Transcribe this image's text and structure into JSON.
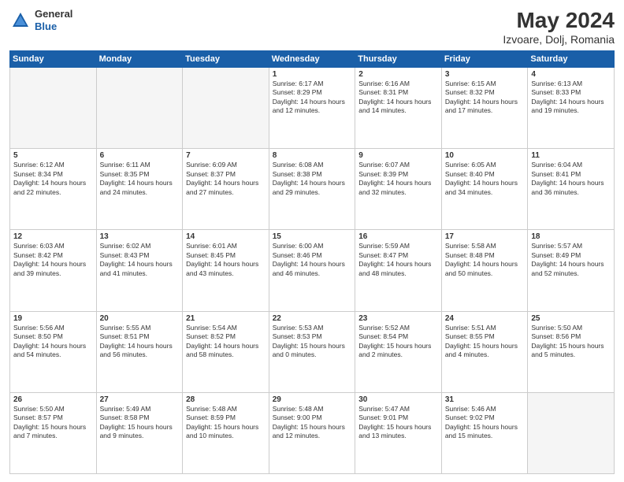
{
  "header": {
    "logo": {
      "general": "General",
      "blue": "Blue"
    },
    "title": "May 2024",
    "subtitle": "Izvoare, Dolj, Romania"
  },
  "days_of_week": [
    "Sunday",
    "Monday",
    "Tuesday",
    "Wednesday",
    "Thursday",
    "Friday",
    "Saturday"
  ],
  "weeks": [
    [
      {
        "day": "",
        "empty": true
      },
      {
        "day": "",
        "empty": true
      },
      {
        "day": "",
        "empty": true
      },
      {
        "day": "1",
        "sunrise": "Sunrise: 6:17 AM",
        "sunset": "Sunset: 8:29 PM",
        "daylight": "Daylight: 14 hours and 12 minutes."
      },
      {
        "day": "2",
        "sunrise": "Sunrise: 6:16 AM",
        "sunset": "Sunset: 8:31 PM",
        "daylight": "Daylight: 14 hours and 14 minutes."
      },
      {
        "day": "3",
        "sunrise": "Sunrise: 6:15 AM",
        "sunset": "Sunset: 8:32 PM",
        "daylight": "Daylight: 14 hours and 17 minutes."
      },
      {
        "day": "4",
        "sunrise": "Sunrise: 6:13 AM",
        "sunset": "Sunset: 8:33 PM",
        "daylight": "Daylight: 14 hours and 19 minutes."
      }
    ],
    [
      {
        "day": "5",
        "sunrise": "Sunrise: 6:12 AM",
        "sunset": "Sunset: 8:34 PM",
        "daylight": "Daylight: 14 hours and 22 minutes."
      },
      {
        "day": "6",
        "sunrise": "Sunrise: 6:11 AM",
        "sunset": "Sunset: 8:35 PM",
        "daylight": "Daylight: 14 hours and 24 minutes."
      },
      {
        "day": "7",
        "sunrise": "Sunrise: 6:09 AM",
        "sunset": "Sunset: 8:37 PM",
        "daylight": "Daylight: 14 hours and 27 minutes."
      },
      {
        "day": "8",
        "sunrise": "Sunrise: 6:08 AM",
        "sunset": "Sunset: 8:38 PM",
        "daylight": "Daylight: 14 hours and 29 minutes."
      },
      {
        "day": "9",
        "sunrise": "Sunrise: 6:07 AM",
        "sunset": "Sunset: 8:39 PM",
        "daylight": "Daylight: 14 hours and 32 minutes."
      },
      {
        "day": "10",
        "sunrise": "Sunrise: 6:05 AM",
        "sunset": "Sunset: 8:40 PM",
        "daylight": "Daylight: 14 hours and 34 minutes."
      },
      {
        "day": "11",
        "sunrise": "Sunrise: 6:04 AM",
        "sunset": "Sunset: 8:41 PM",
        "daylight": "Daylight: 14 hours and 36 minutes."
      }
    ],
    [
      {
        "day": "12",
        "sunrise": "Sunrise: 6:03 AM",
        "sunset": "Sunset: 8:42 PM",
        "daylight": "Daylight: 14 hours and 39 minutes."
      },
      {
        "day": "13",
        "sunrise": "Sunrise: 6:02 AM",
        "sunset": "Sunset: 8:43 PM",
        "daylight": "Daylight: 14 hours and 41 minutes."
      },
      {
        "day": "14",
        "sunrise": "Sunrise: 6:01 AM",
        "sunset": "Sunset: 8:45 PM",
        "daylight": "Daylight: 14 hours and 43 minutes."
      },
      {
        "day": "15",
        "sunrise": "Sunrise: 6:00 AM",
        "sunset": "Sunset: 8:46 PM",
        "daylight": "Daylight: 14 hours and 46 minutes."
      },
      {
        "day": "16",
        "sunrise": "Sunrise: 5:59 AM",
        "sunset": "Sunset: 8:47 PM",
        "daylight": "Daylight: 14 hours and 48 minutes."
      },
      {
        "day": "17",
        "sunrise": "Sunrise: 5:58 AM",
        "sunset": "Sunset: 8:48 PM",
        "daylight": "Daylight: 14 hours and 50 minutes."
      },
      {
        "day": "18",
        "sunrise": "Sunrise: 5:57 AM",
        "sunset": "Sunset: 8:49 PM",
        "daylight": "Daylight: 14 hours and 52 minutes."
      }
    ],
    [
      {
        "day": "19",
        "sunrise": "Sunrise: 5:56 AM",
        "sunset": "Sunset: 8:50 PM",
        "daylight": "Daylight: 14 hours and 54 minutes."
      },
      {
        "day": "20",
        "sunrise": "Sunrise: 5:55 AM",
        "sunset": "Sunset: 8:51 PM",
        "daylight": "Daylight: 14 hours and 56 minutes."
      },
      {
        "day": "21",
        "sunrise": "Sunrise: 5:54 AM",
        "sunset": "Sunset: 8:52 PM",
        "daylight": "Daylight: 14 hours and 58 minutes."
      },
      {
        "day": "22",
        "sunrise": "Sunrise: 5:53 AM",
        "sunset": "Sunset: 8:53 PM",
        "daylight": "Daylight: 15 hours and 0 minutes."
      },
      {
        "day": "23",
        "sunrise": "Sunrise: 5:52 AM",
        "sunset": "Sunset: 8:54 PM",
        "daylight": "Daylight: 15 hours and 2 minutes."
      },
      {
        "day": "24",
        "sunrise": "Sunrise: 5:51 AM",
        "sunset": "Sunset: 8:55 PM",
        "daylight": "Daylight: 15 hours and 4 minutes."
      },
      {
        "day": "25",
        "sunrise": "Sunrise: 5:50 AM",
        "sunset": "Sunset: 8:56 PM",
        "daylight": "Daylight: 15 hours and 5 minutes."
      }
    ],
    [
      {
        "day": "26",
        "sunrise": "Sunrise: 5:50 AM",
        "sunset": "Sunset: 8:57 PM",
        "daylight": "Daylight: 15 hours and 7 minutes."
      },
      {
        "day": "27",
        "sunrise": "Sunrise: 5:49 AM",
        "sunset": "Sunset: 8:58 PM",
        "daylight": "Daylight: 15 hours and 9 minutes."
      },
      {
        "day": "28",
        "sunrise": "Sunrise: 5:48 AM",
        "sunset": "Sunset: 8:59 PM",
        "daylight": "Daylight: 15 hours and 10 minutes."
      },
      {
        "day": "29",
        "sunrise": "Sunrise: 5:48 AM",
        "sunset": "Sunset: 9:00 PM",
        "daylight": "Daylight: 15 hours and 12 minutes."
      },
      {
        "day": "30",
        "sunrise": "Sunrise: 5:47 AM",
        "sunset": "Sunset: 9:01 PM",
        "daylight": "Daylight: 15 hours and 13 minutes."
      },
      {
        "day": "31",
        "sunrise": "Sunrise: 5:46 AM",
        "sunset": "Sunset: 9:02 PM",
        "daylight": "Daylight: 15 hours and 15 minutes."
      },
      {
        "day": "",
        "empty": true
      }
    ]
  ]
}
